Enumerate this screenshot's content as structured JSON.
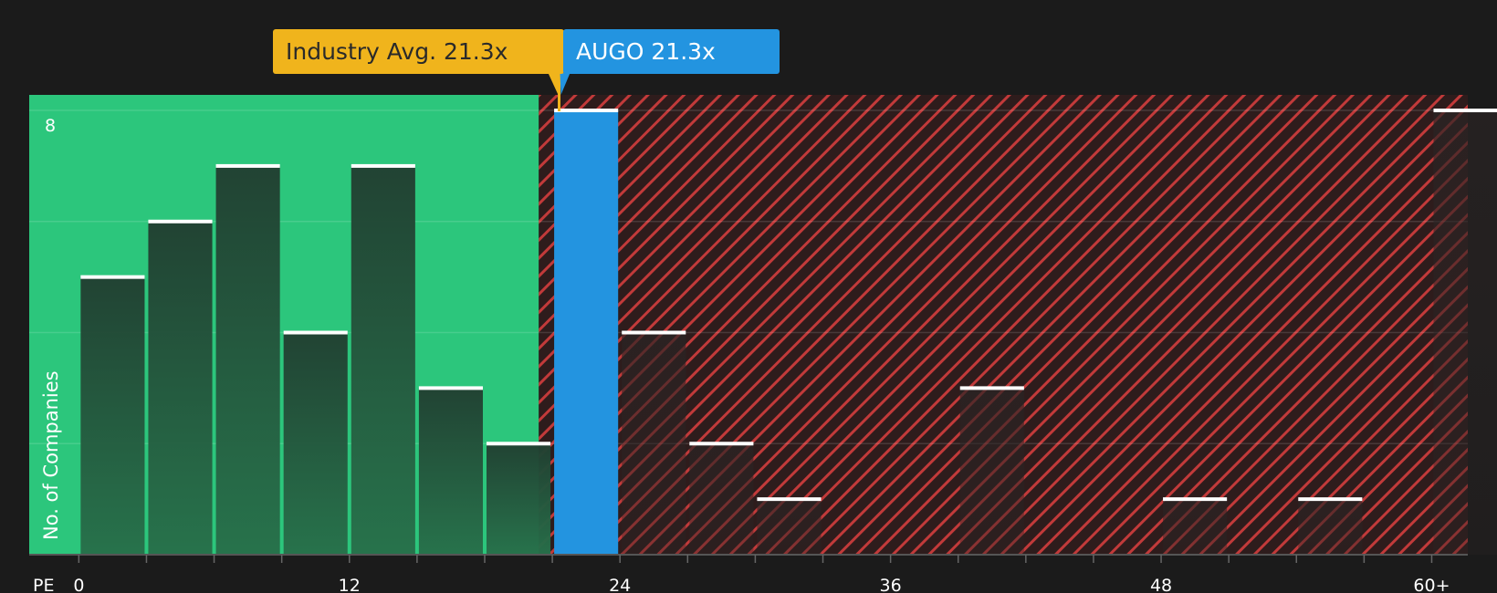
{
  "chart_data": {
    "type": "bar",
    "title": "",
    "xlabel": "PE",
    "ylabel": "No. of Companies",
    "x_ticks": [
      "0",
      "12",
      "24",
      "36",
      "48",
      "60+"
    ],
    "y_ticks": [
      "8"
    ],
    "ylim": [
      0,
      8
    ],
    "xlim": [
      -2.2,
      61.6
    ],
    "bin_width": 3,
    "bins": [
      {
        "start": 0,
        "value": 5
      },
      {
        "start": 3,
        "value": 6
      },
      {
        "start": 6,
        "value": 7
      },
      {
        "start": 9,
        "value": 4
      },
      {
        "start": 12,
        "value": 7
      },
      {
        "start": 15,
        "value": 3
      },
      {
        "start": 18,
        "value": 2
      },
      {
        "start": 24,
        "value": 4
      },
      {
        "start": 27,
        "value": 2
      },
      {
        "start": 30,
        "value": 1
      },
      {
        "start": 39,
        "value": 3
      },
      {
        "start": 48,
        "value": 1
      },
      {
        "start": 54,
        "value": 1
      },
      {
        "start": 60,
        "value": 8
      }
    ],
    "highlight_bin": {
      "start": 21,
      "value": 8,
      "label": "AUGO"
    },
    "industry_avg": 21.3,
    "company_value": 21.3,
    "region_split": 20.4,
    "colors": {
      "background": "#1b1b1b",
      "good_region": "#2cc67c",
      "bad_region": "#c23a3a",
      "bar": "#1f4a36",
      "highlight": "#2394e0",
      "industry": "#f0b41c"
    },
    "grid": true
  },
  "callouts": {
    "industry": "Industry Avg. 21.3x",
    "company": "AUGO 21.3x"
  }
}
